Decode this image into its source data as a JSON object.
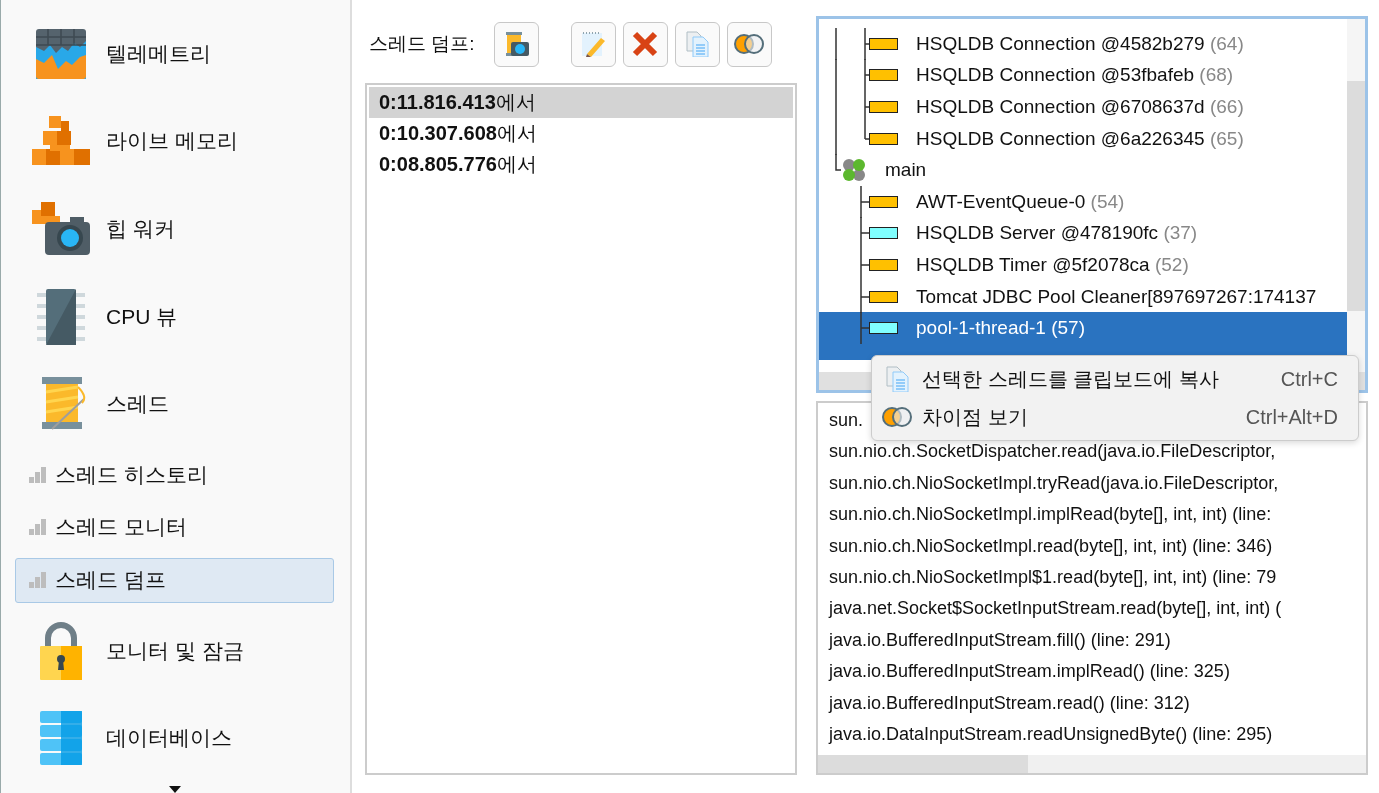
{
  "sidebar": {
    "items": [
      {
        "kind": "large",
        "label": "텔레메트리",
        "selected": false
      },
      {
        "kind": "large",
        "label": "라이브 메모리",
        "selected": false
      },
      {
        "kind": "large",
        "label": "힙 워커",
        "selected": false
      },
      {
        "kind": "large",
        "label": "CPU 뷰",
        "selected": false
      },
      {
        "kind": "large",
        "label": "스레드",
        "selected": false
      },
      {
        "kind": "sub",
        "label": "스레드 히스토리",
        "selected": false
      },
      {
        "kind": "sub",
        "label": "스레드 모니터",
        "selected": false
      },
      {
        "kind": "sub",
        "label": "스레드 덤프",
        "selected": true
      },
      {
        "kind": "large",
        "label": "모니터 및 잠금",
        "selected": false
      },
      {
        "kind": "large",
        "label": "데이터베이스",
        "selected": false
      }
    ]
  },
  "dumps": {
    "label": "스레드 덤프:",
    "items": [
      {
        "text": "**0:11.816.413**에서",
        "selected": true
      },
      {
        "text": "**0:10.307.608**에서",
        "selected": false
      },
      {
        "text": "**0:08.805.776**에서",
        "selected": false
      }
    ]
  },
  "tree": {
    "items": [
      {
        "kind": "thread",
        "label": "HSQLDB Connection @4582b279",
        "id": "(64)",
        "color": "#ffc000",
        "selected": false
      },
      {
        "kind": "thread",
        "label": "HSQLDB Connection @53fbafeb",
        "id": "(68)",
        "color": "#ffc000",
        "selected": false
      },
      {
        "kind": "thread",
        "label": "HSQLDB Connection @6708637d",
        "id": "(66)",
        "color": "#ffc000",
        "selected": false
      },
      {
        "kind": "thread",
        "label": "HSQLDB Connection @6a226345",
        "id": "(65)",
        "color": "#ffc000",
        "selected": false
      },
      {
        "kind": "group",
        "label": "main",
        "children": [
          {
            "kind": "thread",
            "label": "AWT-EventQueue-0",
            "id": "(54)",
            "color": "#ffc000",
            "selected": false
          },
          {
            "kind": "thread",
            "label": "HSQLDB Server @478190fc",
            "id": "(37)",
            "color": "#80ffff",
            "selected": false
          },
          {
            "kind": "thread",
            "label": "HSQLDB Timer @5f2078ca",
            "id": "(52)",
            "color": "#ffc000",
            "selected": false
          },
          {
            "kind": "thread",
            "label": "Tomcat JDBC Pool Cleaner[897697267:174137",
            "color": "#ffc000",
            "selected": false
          },
          {
            "kind": "thread",
            "label": "pool-1-thread-1",
            "id": "(57)",
            "color": "#80ffff",
            "selected": true
          }
        ]
      }
    ]
  },
  "context_menu": {
    "items": [
      {
        "label": "선택한 스레드를 클립보드에 복사",
        "shortcut": "Ctrl+C"
      },
      {
        "label": "차이점 보기",
        "shortcut": "Ctrl+Alt+D"
      }
    ]
  },
  "stack": {
    "lines": [
      "sun.",
      "sun.nio.ch.SocketDispatcher.read(java.io.FileDescriptor,",
      "sun.nio.ch.NioSocketImpl.tryRead(java.io.FileDescriptor,",
      "sun.nio.ch.NioSocketImpl.implRead(byte[], int, int) (line:",
      "sun.nio.ch.NioSocketImpl.read(byte[], int, int) (line: 346)",
      "sun.nio.ch.NioSocketImpl$1.read(byte[], int, int) (line: 79",
      "java.net.Socket$SocketInputStream.read(byte[], int, int) (",
      "java.io.BufferedInputStream.fill() (line: 291)",
      "java.io.BufferedInputStream.implRead() (line: 325)",
      "java.io.BufferedInputStream.read() (line: 312)",
      "java.io.DataInputStream.readUnsignedByte() (line: 295)"
    ]
  }
}
